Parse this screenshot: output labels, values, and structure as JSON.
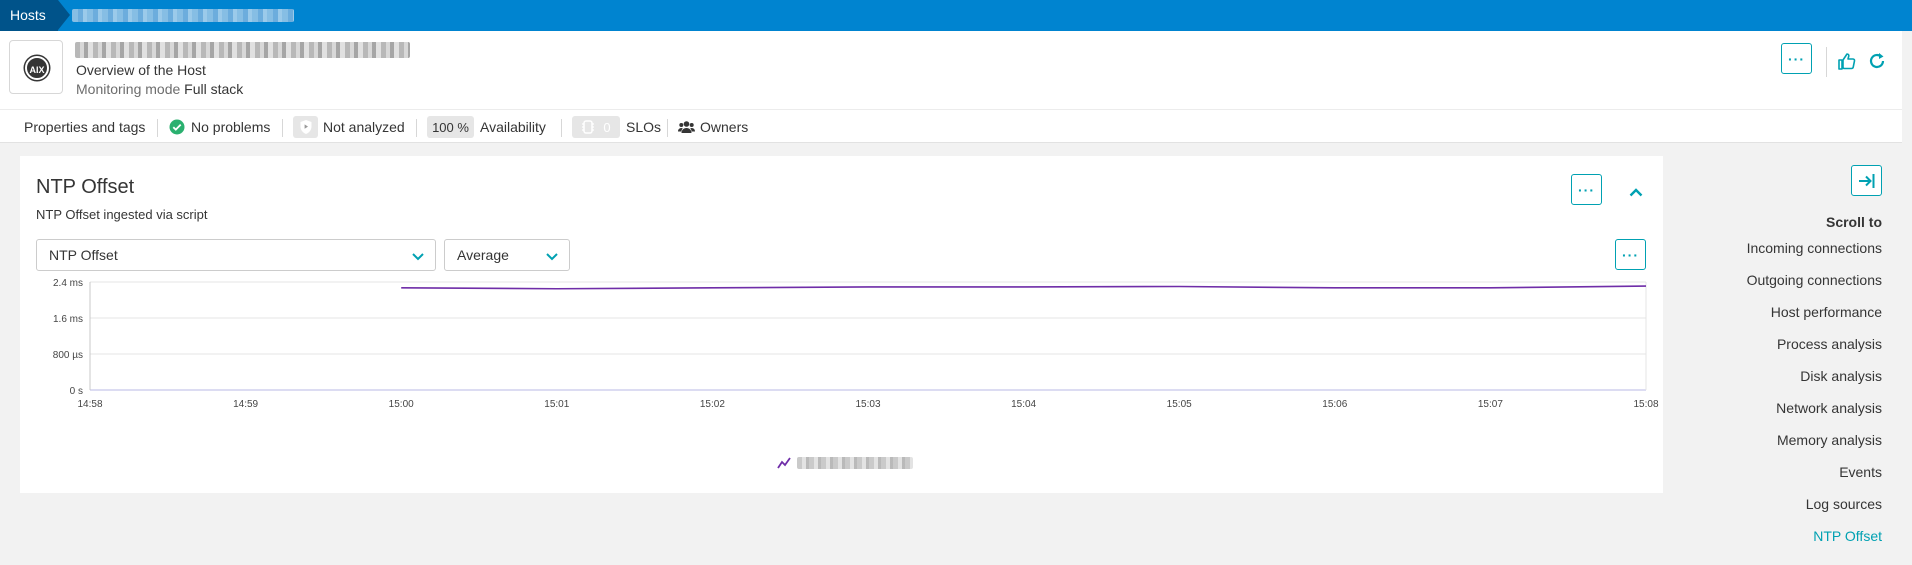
{
  "breadcrumb": {
    "root": "Hosts"
  },
  "header": {
    "os_badge": "AIX",
    "subtitle": "Overview of the Host",
    "monitoring_label": "Monitoring mode",
    "monitoring_value": "Full stack",
    "more_label": "···"
  },
  "infobar": {
    "properties": "Properties and tags",
    "problems": "No problems",
    "analysis": "Not analyzed",
    "availability_value": "100 %",
    "availability_label": "Availability",
    "slo_count": "0",
    "slo_label": "SLOs",
    "owners": "Owners"
  },
  "card": {
    "title": "NTP Offset",
    "subtitle": "NTP Offset ingested via script",
    "metric_select": "NTP Offset",
    "aggregation_select": "Average",
    "more_label": "···"
  },
  "chart_data": {
    "type": "line",
    "x": [
      "14:58",
      "14:59",
      "15:00",
      "15:01",
      "15:02",
      "15:03",
      "15:04",
      "15:05",
      "15:06",
      "15:07",
      "15:08"
    ],
    "y_ticks": [
      "0 s",
      "800 µs",
      "1.6 ms",
      "2.4 ms"
    ],
    "ylim_ms": [
      0,
      2.4
    ],
    "series": [
      {
        "color": "#6f2da8",
        "points": [
          {
            "x": "15:00",
            "y_ms": 2.27
          },
          {
            "x": "15:01",
            "y_ms": 2.25
          },
          {
            "x": "15:02",
            "y_ms": 2.27
          },
          {
            "x": "15:03",
            "y_ms": 2.29
          },
          {
            "x": "15:04",
            "y_ms": 2.29
          },
          {
            "x": "15:05",
            "y_ms": 2.3
          },
          {
            "x": "15:06",
            "y_ms": 2.27
          },
          {
            "x": "15:07",
            "y_ms": 2.27
          },
          {
            "x": "15:08",
            "y_ms": 2.31
          }
        ]
      }
    ],
    "grid": true
  },
  "scroll_nav": {
    "title": "Scroll to",
    "items": [
      "Incoming connections",
      "Outgoing connections",
      "Host performance",
      "Process analysis",
      "Disk analysis",
      "Network analysis",
      "Memory analysis",
      "Events",
      "Log sources",
      "NTP Offset"
    ],
    "active": "NTP Offset"
  },
  "colors": {
    "brand": "#0084d0",
    "accent": "#00a1b2",
    "series": "#6f2da8",
    "ok": "#2ab06f"
  }
}
